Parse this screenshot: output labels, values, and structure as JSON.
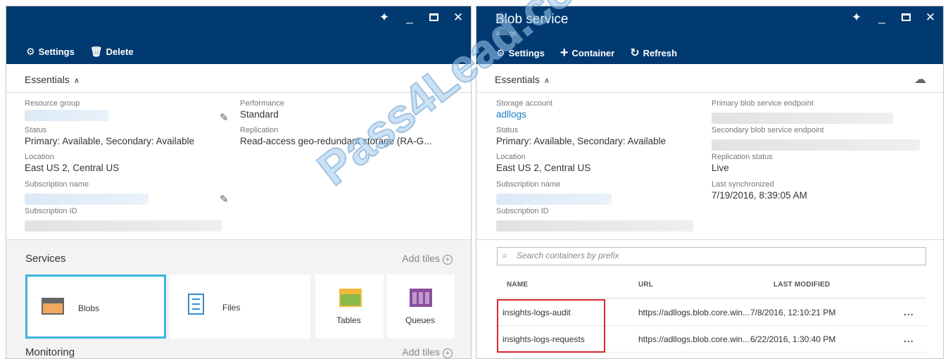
{
  "left": {
    "commands": {
      "settings": "Settings",
      "delete": "Delete"
    },
    "essentials": "Essentials",
    "fields": {
      "resource_group_label": "Resource group",
      "status_label": "Status",
      "status_value": "Primary: Available, Secondary: Available",
      "location_label": "Location",
      "location_value": "East US 2, Central US",
      "subscription_name_label": "Subscription name",
      "subscription_id_label": "Subscription ID",
      "performance_label": "Performance",
      "performance_value": "Standard",
      "replication_label": "Replication",
      "replication_value": "Read-access geo-redundant storage (RA-G..."
    },
    "services": {
      "title": "Services",
      "add_tiles": "Add tiles",
      "tiles": [
        "Blobs",
        "Files",
        "Tables",
        "Queues"
      ]
    },
    "monitoring": {
      "title": "Monitoring",
      "add_tiles": "Add tiles"
    }
  },
  "right": {
    "title": "Blob service",
    "subtitle": "adllogs",
    "commands": {
      "settings": "Settings",
      "container": "Container",
      "refresh": "Refresh"
    },
    "essentials": "Essentials",
    "fields": {
      "storage_account_label": "Storage account",
      "storage_account_value": "adllogs",
      "status_label": "Status",
      "status_value": "Primary: Available, Secondary: Available",
      "location_label": "Location",
      "location_value": "East US 2, Central US",
      "subscription_name_label": "Subscription name",
      "subscription_id_label": "Subscription ID",
      "primary_endpoint_label": "Primary blob service endpoint",
      "secondary_endpoint_label": "Secondary blob service endpoint",
      "replication_status_label": "Replication status",
      "replication_status_value": "Live",
      "last_sync_label": "Last synchronized",
      "last_sync_value": "7/19/2016, 8:39:05 AM"
    },
    "search": {
      "placeholder": "Search containers by prefix"
    },
    "table": {
      "headers": {
        "name": "NAME",
        "url": "URL",
        "modified": "LAST MODIFIED"
      },
      "rows": [
        {
          "name": "insights-logs-audit",
          "url": "https://adllogs.blob.core.win...",
          "modified": "7/8/2016, 12:10:21 PM",
          "more": "..."
        },
        {
          "name": "insights-logs-requests",
          "url": "https://adllogs.blob.core.win...",
          "modified": "6/22/2016, 1:30:40 PM",
          "more": "..."
        }
      ]
    }
  },
  "watermark": "Pass4Lead.com",
  "colors": {
    "header": "#003a70",
    "accent": "#1a7bc4",
    "tile_selected": "#3db4e0",
    "highlight": "#d9262c"
  }
}
